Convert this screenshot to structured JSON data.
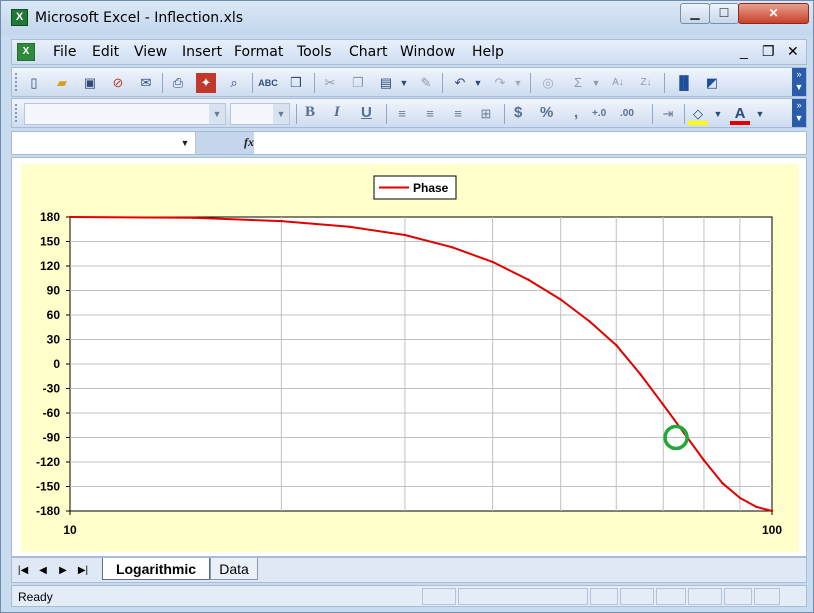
{
  "window": {
    "title": "Microsoft Excel - Inflection.xls",
    "app_icon": "excel-icon",
    "controls": [
      "minimize-icon",
      "maximize-icon",
      "close-icon"
    ]
  },
  "menu": {
    "items": [
      "File",
      "Edit",
      "View",
      "Insert",
      "Format",
      "Tools",
      "Chart",
      "Window",
      "Help"
    ],
    "mdi_controls": [
      "_",
      "❐",
      "✕"
    ]
  },
  "toolbar_standard": {
    "icons": [
      "new-icon",
      "open-icon",
      "save-icon",
      "permission-icon",
      "email-icon",
      "print-icon",
      "research-icon",
      "print-preview-icon",
      "spelling-icon",
      "research-book-icon",
      "cut-icon",
      "copy-icon",
      "paste-icon",
      "format-painter-icon",
      "undo-icon",
      "redo-icon",
      "hyperlink-icon",
      "autosum-icon",
      "sort-ascending-icon",
      "sort-descending-icon",
      "chart-wizard-icon",
      "drawing-icon"
    ]
  },
  "toolbar_formatting": {
    "font_name": "",
    "font_size": "",
    "bold": "B",
    "italic": "I",
    "underline": "U",
    "currency": "$",
    "percent": "%",
    "comma": ",",
    "increase_decimal": "+.0",
    "decrease_decimal": ".00",
    "fill_color": "#ffff00",
    "font_color": "#e00000"
  },
  "formula_bar": {
    "name_box": "",
    "fx_label": "fx",
    "content": ""
  },
  "chart_data": {
    "type": "line",
    "title": "",
    "xlabel": "",
    "ylabel": "",
    "x_scale": "log",
    "xlim": [
      10,
      100
    ],
    "x_tick_labels": [
      "10",
      "100"
    ],
    "ylim": [
      -180,
      180
    ],
    "y_ticks": [
      180,
      150,
      120,
      90,
      60,
      30,
      0,
      -30,
      -60,
      -90,
      -120,
      -150,
      -180
    ],
    "grid": true,
    "legend_position": "top-center",
    "series": [
      {
        "name": "Phase",
        "color": "#e00000",
        "x": [
          10,
          15,
          20,
          25,
          30,
          35,
          40,
          45,
          50,
          55,
          60,
          65,
          70,
          75,
          80,
          85,
          90,
          95,
          100
        ],
        "y": [
          180,
          179,
          175,
          168,
          158,
          143,
          125,
          103,
          79,
          52,
          23,
          -13,
          -50,
          -85,
          -118,
          -146,
          -164,
          -175,
          -180
        ]
      }
    ],
    "annotation": {
      "shape": "circle",
      "color": "#22a83a",
      "x": 73,
      "y": -90
    }
  },
  "sheet_tabs": {
    "nav_icons": [
      "first-sheet-icon",
      "prev-sheet-icon",
      "next-sheet-icon",
      "last-sheet-icon"
    ],
    "tabs": [
      "Logarithmic",
      "Data"
    ],
    "active": "Logarithmic"
  },
  "status": {
    "text": "Ready"
  }
}
